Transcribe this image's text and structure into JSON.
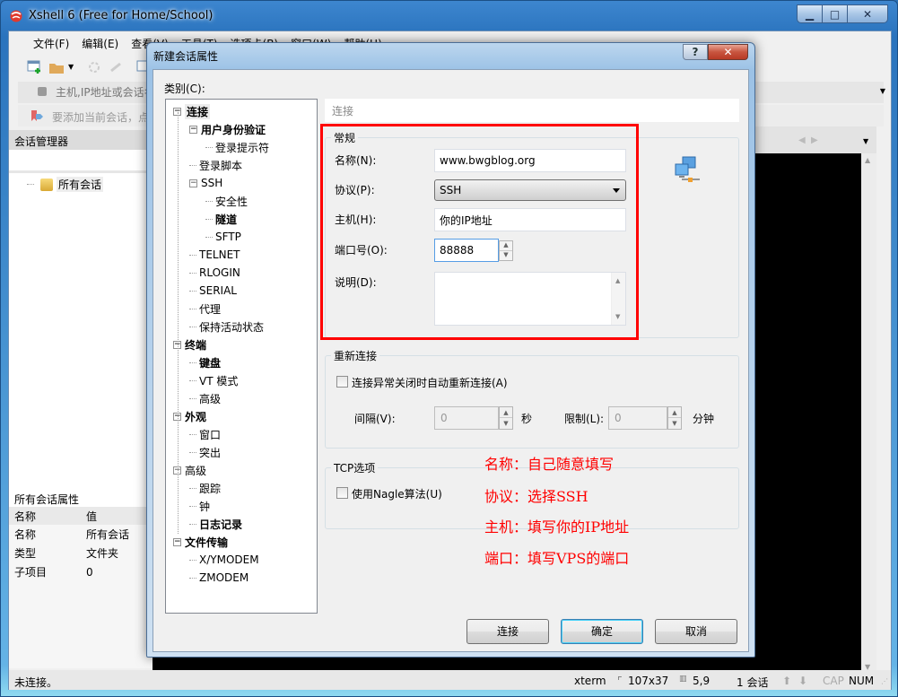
{
  "app": {
    "title": "Xshell 6 (Free for Home/School)",
    "window_controls": {
      "minimize": "▁",
      "maximize": "□",
      "close": "✕"
    }
  },
  "menu": [
    "文件(F)",
    "编辑(E)",
    "查看(V)",
    "工具(T)",
    "选项卡(B)",
    "窗口(W)",
    "帮助(H)"
  ],
  "address_bar": {
    "placeholder": "主机,IP地址或会话名称",
    "hint": "要添加当前会话，点击左侧的箭头按钮。"
  },
  "session_manager": {
    "title": "会话管理器",
    "tree_root": "所有会话"
  },
  "properties": {
    "title": "所有会话属性",
    "columns": [
      "名称",
      "值"
    ],
    "rows": [
      {
        "key": "名称",
        "value": "所有会话"
      },
      {
        "key": "类型",
        "value": "文件夹"
      },
      {
        "key": "子项目",
        "value": "0"
      }
    ]
  },
  "status_bar": {
    "connection": "未连接。",
    "terminal_type": "xterm",
    "size": "107x37",
    "cursor": "5,9",
    "sessions": "1 会话",
    "cap": "CAP",
    "num": "NUM"
  },
  "dialog": {
    "title": "新建会话属性",
    "help": "?",
    "close": "✕",
    "category_label": "类别(C):",
    "tree": [
      {
        "label": "连接",
        "level": 0,
        "bold": true,
        "expander": true,
        "selected": true
      },
      {
        "label": "用户身份验证",
        "level": 1,
        "bold": true,
        "expander": true
      },
      {
        "label": "登录提示符",
        "level": 2
      },
      {
        "label": "登录脚本",
        "level": 1
      },
      {
        "label": "SSH",
        "level": 1,
        "expander": true
      },
      {
        "label": "安全性",
        "level": 2
      },
      {
        "label": "隧道",
        "level": 2,
        "bold": true
      },
      {
        "label": "SFTP",
        "level": 2
      },
      {
        "label": "TELNET",
        "level": 1
      },
      {
        "label": "RLOGIN",
        "level": 1
      },
      {
        "label": "SERIAL",
        "level": 1
      },
      {
        "label": "代理",
        "level": 1
      },
      {
        "label": "保持活动状态",
        "level": 1
      },
      {
        "label": "终端",
        "level": 0,
        "bold": true,
        "expander": true
      },
      {
        "label": "键盘",
        "level": 1,
        "bold": true
      },
      {
        "label": "VT 模式",
        "level": 1
      },
      {
        "label": "高级",
        "level": 1
      },
      {
        "label": "外观",
        "level": 0,
        "bold": true,
        "expander": true
      },
      {
        "label": "窗口",
        "level": 1
      },
      {
        "label": "突出",
        "level": 1
      },
      {
        "label": "高级",
        "level": 0,
        "expander": true
      },
      {
        "label": "跟踪",
        "level": 1
      },
      {
        "label": "钟",
        "level": 1
      },
      {
        "label": "日志记录",
        "level": 1,
        "bold": true
      },
      {
        "label": "文件传输",
        "level": 0,
        "bold": true,
        "expander": true
      },
      {
        "label": "X/YMODEM",
        "level": 1
      },
      {
        "label": "ZMODEM",
        "level": 1
      }
    ],
    "section_title": "连接",
    "general": {
      "title": "常规",
      "name_label": "名称(N):",
      "name_value": "www.bwgblog.org",
      "protocol_label": "协议(P):",
      "protocol_value": "SSH",
      "host_label": "主机(H):",
      "host_value": "你的IP地址",
      "port_label": "端口号(O):",
      "port_value": "88888",
      "desc_label": "说明(D):",
      "desc_value": ""
    },
    "reconnect": {
      "title": "重新连接",
      "checkbox_label": "连接异常关闭时自动重新连接(A)",
      "checked": false,
      "interval_label": "间隔(V):",
      "interval_value": "0",
      "interval_unit": "秒",
      "limit_label": "限制(L):",
      "limit_value": "0",
      "limit_unit": "分钟"
    },
    "tcp": {
      "title": "TCP选项",
      "nagle_label": "使用Nagle算法(U)",
      "checked": false
    },
    "buttons": {
      "connect": "连接",
      "ok": "确定",
      "cancel": "取消"
    }
  },
  "annotations": [
    "名称：自己随意填写",
    "协议：选择SSH",
    "主机：填写你的IP地址",
    "端口：填写VPS的端口"
  ],
  "colors": {
    "annotation": "#ff0000",
    "terminal_bg": "#000000"
  }
}
